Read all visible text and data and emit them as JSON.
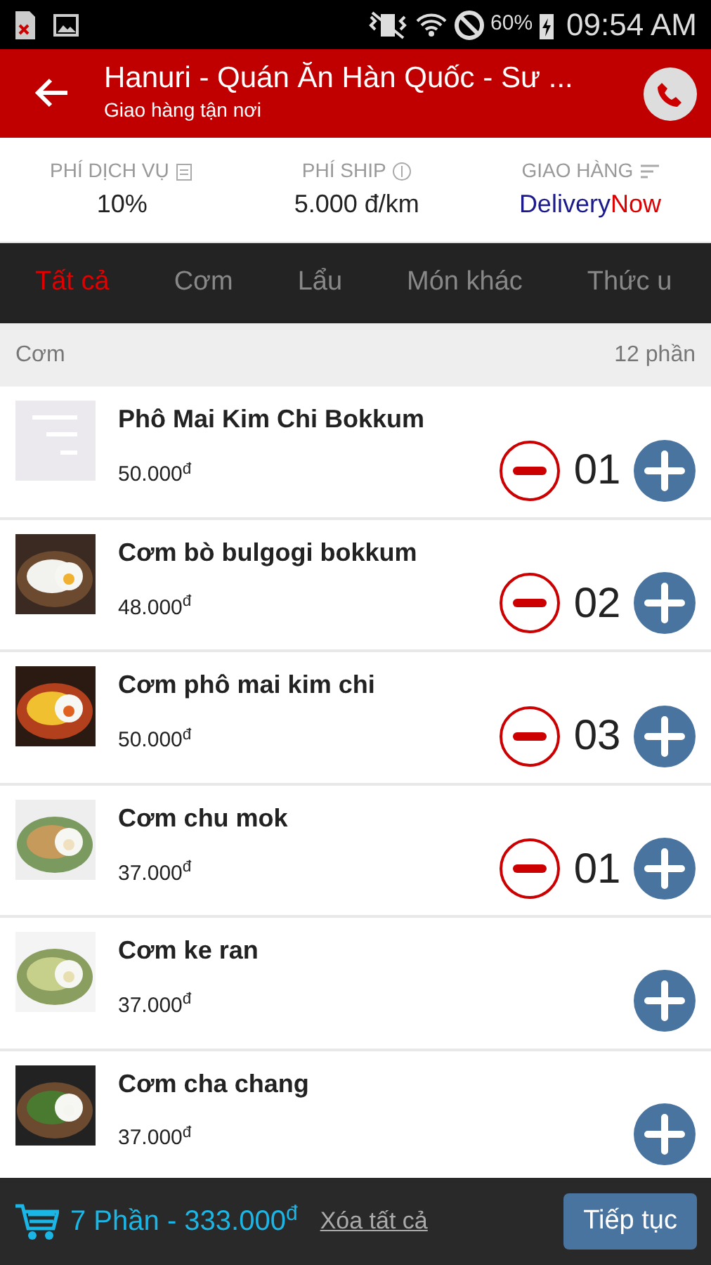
{
  "status_bar": {
    "battery": "60%",
    "time": "09:54 AM"
  },
  "header": {
    "title": "Hanuri - Quán Ăn Hàn Quốc - Sư ...",
    "subtitle": "Giao hàng tận nơi"
  },
  "info": [
    {
      "kind": "fee",
      "label": "PHÍ DỊCH VỤ",
      "value": "10%"
    },
    {
      "kind": "ship",
      "label": "PHÍ SHIP",
      "value": "5.000 đ/km"
    },
    {
      "kind": "delivery",
      "label": "GIAO HÀNG",
      "value": "Delivery",
      "value_accent": "Now"
    }
  ],
  "tabs": [
    {
      "label": "Tất cả",
      "selected": true
    },
    {
      "label": "Cơm",
      "selected": false
    },
    {
      "label": "Lẩu",
      "selected": false
    },
    {
      "label": "Món khác",
      "selected": false
    },
    {
      "label": "Thức u",
      "selected": false
    }
  ],
  "section": {
    "title": "Cơm",
    "count": "12 phần"
  },
  "items": [
    {
      "name": "Phô Mai Kim Chi Bokkum",
      "price": "50.000$^{đ}$",
      "kind": "placeholder",
      "quantity": "01"
    },
    {
      "name": "Cơm bò bulgogi bokkum",
      "price": "48.000$^{đ}$",
      "kind": "picture",
      "quantity": "02"
    },
    {
      "name": "Cơm phô mai kim chi",
      "price": "50.000$^{đ}$",
      "kind": "picture",
      "quantity": "03"
    },
    {
      "name": "Cơm chu mok",
      "price": "37.000$^{đ}$",
      "kind": "picture",
      "quantity": "01"
    },
    {
      "name": "Cơm ke ran",
      "price": "37.000$^{đ}$",
      "kind": "picture"
    },
    {
      "name": "Cơm cha chang",
      "price": "37.000$^{đ}$",
      "kind": "picture"
    }
  ],
  "cart": {
    "summary": "7 Phần - 333.000$^{đ}$",
    "clear": "Xóa tất cả",
    "button": "Tiếp tục"
  }
}
